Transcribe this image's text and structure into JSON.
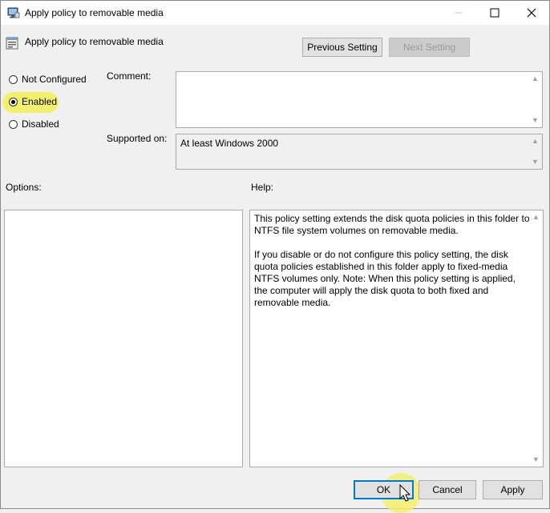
{
  "window": {
    "title": "Apply policy to removable media",
    "controls": {
      "minimize": "minimize",
      "maximize": "maximize",
      "close": "close"
    }
  },
  "header": {
    "policy_name": "Apply policy to removable media",
    "previous_label": "Previous Setting",
    "next_label": "Next Setting"
  },
  "state": {
    "options": [
      {
        "label": "Not Configured",
        "checked": false
      },
      {
        "label": "Enabled",
        "checked": true
      },
      {
        "label": "Disabled",
        "checked": false
      }
    ]
  },
  "comment": {
    "label": "Comment:",
    "value": ""
  },
  "supported": {
    "label": "Supported on:",
    "value": "At least Windows 2000"
  },
  "options_panel": {
    "label": "Options:"
  },
  "help_panel": {
    "label": "Help:",
    "text": "This policy setting extends the disk quota policies in this folder to NTFS file system volumes on removable media.\n\nIf you disable or do not configure this policy setting, the disk quota policies established in this folder apply to fixed-media NTFS volumes only. Note: When this policy setting is applied, the computer will apply the disk quota to both fixed and removable media."
  },
  "footer": {
    "ok_label": "OK",
    "cancel_label": "Cancel",
    "apply_label": "Apply"
  },
  "colors": {
    "accent": "#0078d7",
    "highlight": "#f3f06b"
  }
}
